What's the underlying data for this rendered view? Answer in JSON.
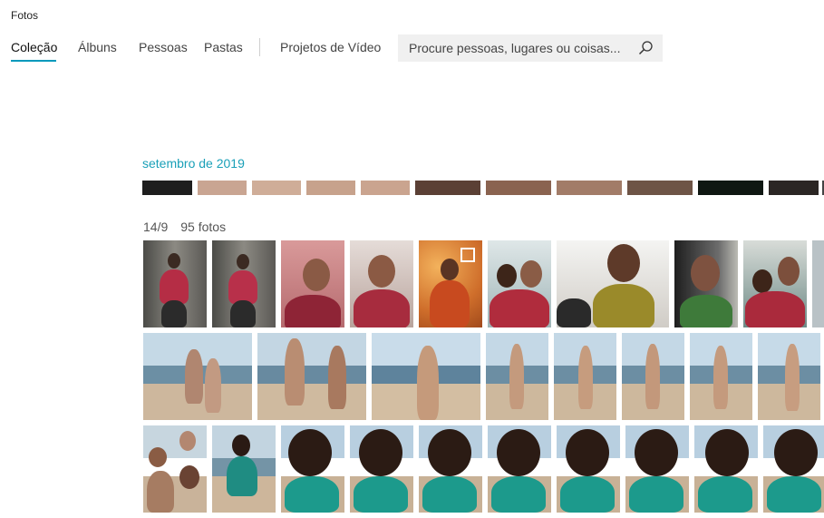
{
  "app": {
    "title": "Fotos"
  },
  "nav": {
    "tabs": [
      {
        "label": "Coleção"
      },
      {
        "label": "Álbuns"
      },
      {
        "label": "Pessoas"
      },
      {
        "label": "Pastas"
      },
      {
        "label": "Projetos de Vídeo"
      }
    ],
    "active_tab": "Coleção"
  },
  "search": {
    "placeholder": "Procure pessoas, lugares ou coisas..."
  },
  "collection": {
    "month_heading": "setembro de 2019",
    "day_group": {
      "date": "14/9",
      "count": "95 fotos"
    }
  },
  "colors": {
    "accent": "#0099bc",
    "month_text": "#1aa0b8"
  },
  "icons": {
    "search": "search-icon",
    "select": "checkbox-icon"
  }
}
